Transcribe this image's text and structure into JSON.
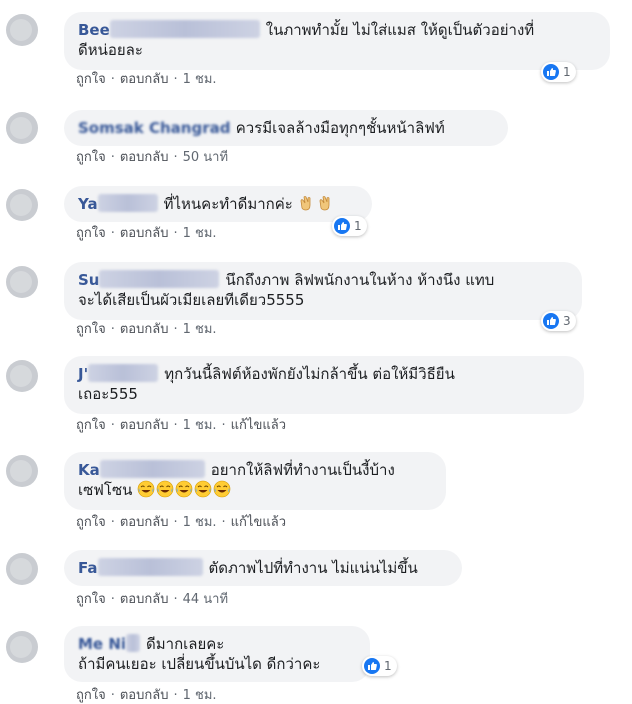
{
  "comments": [
    {
      "name_visible": "Bee",
      "text": "ในภาพทำมั้ย ไม่ใส่แมส ให้ดูเป็นตัวอย่างที่",
      "text2": "ดีหน่อยละ",
      "like": "ถูกใจ",
      "reply": "ตอบกลับ",
      "time": "1 ชม.",
      "reactions": "1"
    },
    {
      "name_visible": "Somsak Changrad",
      "text": "ควรมีเจลล้างมือทุกๆชั้นหน้าลิฟท์",
      "like": "ถูกใจ",
      "reply": "ตอบกลับ",
      "time": "50 นาที"
    },
    {
      "name_visible": "Ya",
      "text": "ที่ไหนคะทำดีมากค่ะ",
      "emoji": "clap",
      "like": "ถูกใจ",
      "reply": "ตอบกลับ",
      "time": "1 ชม.",
      "reactions": "1"
    },
    {
      "name_visible": "Su",
      "text": "นึกถึงภาพ ลิฟพนักงานในห้าง ห้างนึง แทบ",
      "text2": "จะได้เสียเป็นผัวเมียเลยทีเดียว5555",
      "like": "ถูกใจ",
      "reply": "ตอบกลับ",
      "time": "1 ชม.",
      "reactions": "3"
    },
    {
      "name_visible": "J'",
      "text": "ทุกวันนี้ลิฟต์ห้องพักยังไม่กล้าขึ้น ต่อให้มีวิธียืน",
      "text2": "เถอะ555",
      "like": "ถูกใจ",
      "reply": "ตอบกลับ",
      "time": "1 ชม.",
      "edited": "แก้ไขแล้ว"
    },
    {
      "name_visible": "Ka",
      "text": "อยากให้ลิฟที่ทำงานเป็นงี้บ้าง",
      "text2": "เซฟโซน",
      "emoji": "laugh",
      "like": "ถูกใจ",
      "reply": "ตอบกลับ",
      "time": "1 ชม.",
      "edited": "แก้ไขแล้ว"
    },
    {
      "name_visible": "Fa",
      "text": "ตัดภาพไปที่ทำงาน ไม่แน่นไม่ขึ้น",
      "like": "ถูกใจ",
      "reply": "ตอบกลับ",
      "time": "44 นาที"
    },
    {
      "name_visible": "Me Ni",
      "text": "ดีมากเลยคะ",
      "text2": "ถ้ามีคนเยอะ เปลี่ยนขึ้นบันได ดีกว่าคะ",
      "like": "ถูกใจ",
      "reply": "ตอบกลับ",
      "time": "1 ชม.",
      "reactions": "1"
    }
  ],
  "colors": {
    "name": "#385898",
    "bubble": "#f2f3f5",
    "like": "#1877f2"
  },
  "icons": {
    "like": "thumbs-up-icon",
    "clap": "clapping-hands-icon",
    "laugh": "tears-of-joy-icon"
  }
}
